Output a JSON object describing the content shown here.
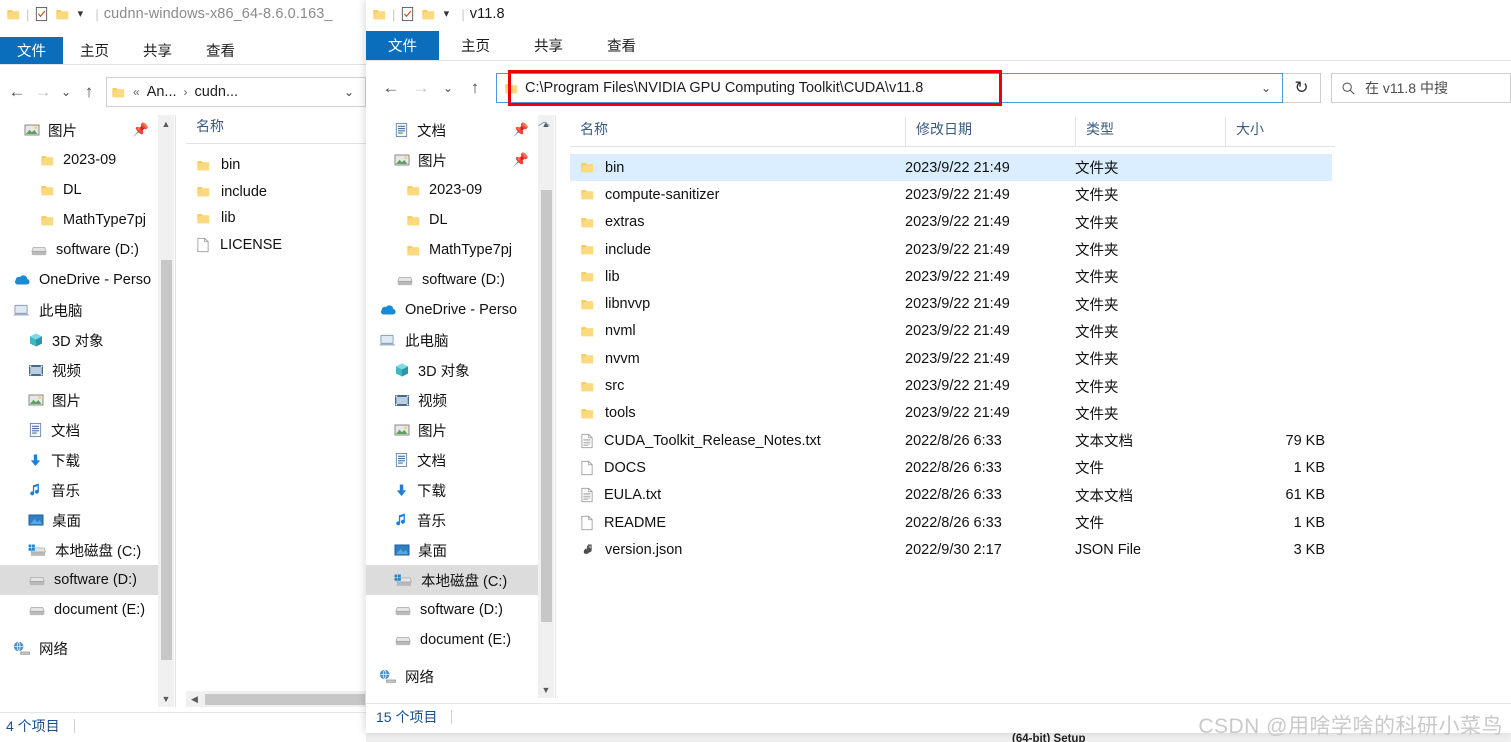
{
  "back_window": {
    "title": "cudnn-windows-x86_64-8.6.0.163_",
    "tabs": [
      "文件",
      "主页",
      "共享",
      "查看"
    ],
    "active_tab": "文件",
    "breadcrumb": {
      "prefix": "«",
      "parts": [
        "An...",
        "cudn..."
      ]
    },
    "nav_items": [
      {
        "label": "图片",
        "icon": "pictures-icon",
        "pinned": true
      },
      {
        "label": "2023-09",
        "icon": "folder-icon"
      },
      {
        "label": "DL",
        "icon": "folder-icon"
      },
      {
        "label": "MathType7pj",
        "icon": "folder-icon"
      },
      {
        "label": "software (D:)",
        "icon": "drive-icon"
      },
      {
        "label": "OneDrive - Perso",
        "icon": "onedrive-icon"
      },
      {
        "label": "此电脑",
        "icon": "this-pc-icon"
      },
      {
        "label": "3D 对象",
        "icon": "3d-objects-icon"
      },
      {
        "label": "视频",
        "icon": "videos-icon"
      },
      {
        "label": "图片",
        "icon": "pictures-icon"
      },
      {
        "label": "文档",
        "icon": "documents-icon"
      },
      {
        "label": "下载",
        "icon": "downloads-icon"
      },
      {
        "label": "音乐",
        "icon": "music-icon"
      },
      {
        "label": "桌面",
        "icon": "desktop-icon"
      },
      {
        "label": "本地磁盘 (C:)",
        "icon": "system-drive-icon"
      },
      {
        "label": "software (D:)",
        "icon": "drive-icon",
        "selected": true
      },
      {
        "label": "document (E:)",
        "icon": "drive-icon"
      },
      {
        "label": "网络",
        "icon": "network-icon"
      }
    ],
    "column_header": "名称",
    "files": [
      {
        "name": "bin",
        "icon": "folder-icon"
      },
      {
        "name": "include",
        "icon": "folder-icon"
      },
      {
        "name": "lib",
        "icon": "folder-icon"
      },
      {
        "name": "LICENSE",
        "icon": "blank-file-icon"
      }
    ],
    "status": "4 个项目"
  },
  "front_window": {
    "title": "v11.8",
    "tabs": [
      "文件",
      "主页",
      "共享",
      "查看"
    ],
    "active_tab": "文件",
    "address_value": "C:\\Program Files\\NVIDIA GPU Computing Toolkit\\CUDA\\v11.8",
    "search_placeholder": "在 v11.8 中搜",
    "highlight_color": "#ef0000",
    "accent_color": "#0b6ebd",
    "selection_color": "#cce8ff",
    "nav_items": [
      {
        "label": "文档",
        "icon": "documents-icon",
        "pinned": true
      },
      {
        "label": "图片",
        "icon": "pictures-icon",
        "pinned": true
      },
      {
        "label": "2023-09",
        "icon": "folder-icon"
      },
      {
        "label": "DL",
        "icon": "folder-icon"
      },
      {
        "label": "MathType7pj",
        "icon": "folder-icon"
      },
      {
        "label": "software (D:)",
        "icon": "drive-icon"
      },
      {
        "label": "OneDrive - Perso",
        "icon": "onedrive-icon"
      },
      {
        "label": "此电脑",
        "icon": "this-pc-icon"
      },
      {
        "label": "3D 对象",
        "icon": "3d-objects-icon"
      },
      {
        "label": "视频",
        "icon": "videos-icon"
      },
      {
        "label": "图片",
        "icon": "pictures-icon"
      },
      {
        "label": "文档",
        "icon": "documents-icon"
      },
      {
        "label": "下载",
        "icon": "downloads-icon"
      },
      {
        "label": "音乐",
        "icon": "music-icon"
      },
      {
        "label": "桌面",
        "icon": "desktop-icon"
      },
      {
        "label": "本地磁盘 (C:)",
        "icon": "system-drive-icon",
        "selected": true
      },
      {
        "label": "software (D:)",
        "icon": "drive-icon"
      },
      {
        "label": "document (E:)",
        "icon": "drive-icon"
      },
      {
        "label": "网络",
        "icon": "network-icon"
      }
    ],
    "columns": [
      "名称",
      "修改日期",
      "类型",
      "大小"
    ],
    "sort_column": "名称",
    "sort_direction": "asc",
    "files": [
      {
        "name": "bin",
        "date": "2023/9/22 21:49",
        "type": "文件夹",
        "size": "",
        "icon": "folder-icon",
        "selected": true
      },
      {
        "name": "compute-sanitizer",
        "date": "2023/9/22 21:49",
        "type": "文件夹",
        "size": "",
        "icon": "folder-icon"
      },
      {
        "name": "extras",
        "date": "2023/9/22 21:49",
        "type": "文件夹",
        "size": "",
        "icon": "folder-icon"
      },
      {
        "name": "include",
        "date": "2023/9/22 21:49",
        "type": "文件夹",
        "size": "",
        "icon": "folder-icon"
      },
      {
        "name": "lib",
        "date": "2023/9/22 21:49",
        "type": "文件夹",
        "size": "",
        "icon": "folder-icon"
      },
      {
        "name": "libnvvp",
        "date": "2023/9/22 21:49",
        "type": "文件夹",
        "size": "",
        "icon": "folder-icon"
      },
      {
        "name": "nvml",
        "date": "2023/9/22 21:49",
        "type": "文件夹",
        "size": "",
        "icon": "folder-icon"
      },
      {
        "name": "nvvm",
        "date": "2023/9/22 21:49",
        "type": "文件夹",
        "size": "",
        "icon": "folder-icon"
      },
      {
        "name": "src",
        "date": "2023/9/22 21:49",
        "type": "文件夹",
        "size": "",
        "icon": "folder-icon"
      },
      {
        "name": "tools",
        "date": "2023/9/22 21:49",
        "type": "文件夹",
        "size": "",
        "icon": "folder-icon"
      },
      {
        "name": "CUDA_Toolkit_Release_Notes.txt",
        "date": "2022/8/26 6:33",
        "type": "文本文档",
        "size": "79 KB",
        "icon": "text-file-icon"
      },
      {
        "name": "DOCS",
        "date": "2022/8/26 6:33",
        "type": "文件",
        "size": "1 KB",
        "icon": "blank-file-icon"
      },
      {
        "name": "EULA.txt",
        "date": "2022/8/26 6:33",
        "type": "文本文档",
        "size": "61 KB",
        "icon": "text-file-icon"
      },
      {
        "name": "README",
        "date": "2022/8/26 6:33",
        "type": "文件",
        "size": "1 KB",
        "icon": "blank-file-icon"
      },
      {
        "name": "version.json",
        "date": "2022/9/30 2:17",
        "type": "JSON File",
        "size": "3 KB",
        "icon": "json-file-icon"
      }
    ],
    "status": "15 个项目"
  },
  "background": {
    "setup_label": "(64-bit) Setup"
  },
  "watermark": "CSDN @用啥学啥的科研小菜鸟"
}
